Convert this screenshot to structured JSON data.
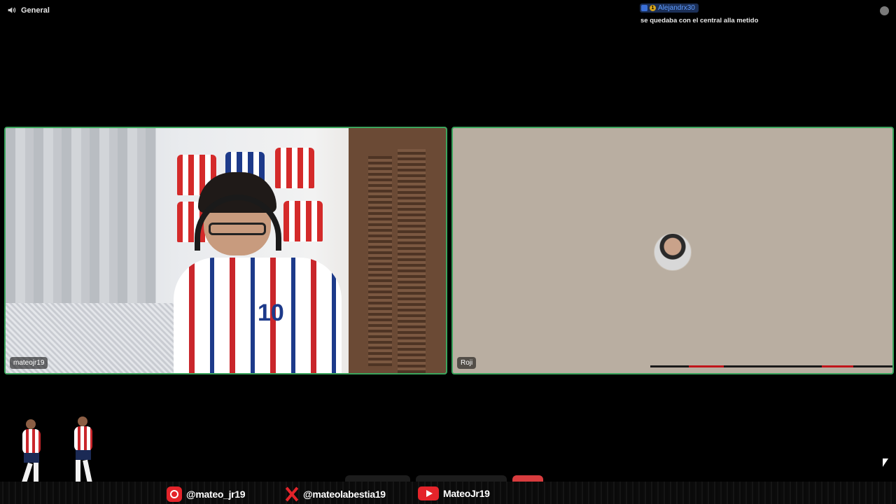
{
  "channel": {
    "name": "General",
    "icon": "speaker-icon"
  },
  "chat": {
    "username": "Alejandrx30",
    "badge_count": "1",
    "message": "se quedaba con el central alla metido"
  },
  "tiles": [
    {
      "name": "mateojr19"
    },
    {
      "name": "Roji"
    }
  ],
  "socials": [
    {
      "icon": "instagram-icon",
      "handle": "@mateo_jr19"
    },
    {
      "icon": "x-icon",
      "handle": "@mateolabestia19"
    },
    {
      "icon": "youtube-icon",
      "handle": "MateoJr19"
    }
  ],
  "colors": {
    "speaking_border": "#3ba55d",
    "overlay_accent": "#e4242a",
    "chat_user": "#5f9cff"
  }
}
